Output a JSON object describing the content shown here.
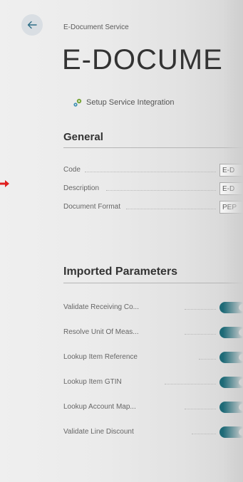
{
  "header": {
    "breadcrumb": "E-Document Service",
    "title": "E-DOCUME"
  },
  "actions": {
    "setup_service_integration": "Setup Service Integration"
  },
  "general": {
    "header": "General",
    "fields": [
      {
        "label": "Code",
        "value": "E-D"
      },
      {
        "label": "Description",
        "value": "E-D"
      },
      {
        "label": "Document Format",
        "value": "PEP"
      }
    ]
  },
  "imported_parameters": {
    "header": "Imported Parameters",
    "toggles": [
      {
        "label": "Validate Receiving Co...",
        "enabled": true
      },
      {
        "label": "Resolve Unit Of Meas...",
        "enabled": true
      },
      {
        "label": "Lookup Item Reference",
        "enabled": true
      },
      {
        "label": "Lookup Item GTIN",
        "enabled": true
      },
      {
        "label": "Lookup Account Map...",
        "enabled": true
      },
      {
        "label": "Validate Line Discount",
        "enabled": true
      }
    ]
  },
  "colors": {
    "accent_toggle": "#1e6a77",
    "pointer_arrow": "#e02020"
  },
  "icons": {
    "back": "back-arrow-icon",
    "setup": "setup-gear-icon",
    "pointer": "red-pointer-arrow-icon"
  }
}
